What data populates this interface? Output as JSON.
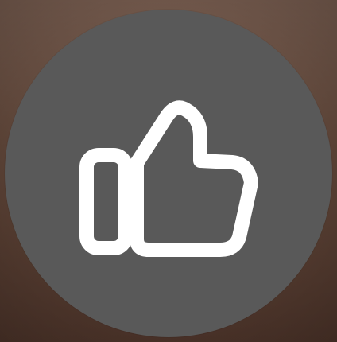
{
  "background": {
    "color_top": "#755b4e",
    "color_bottom": "#4b3329"
  },
  "like_button": {
    "icon": "thumbs-up-icon",
    "fill": "#595959",
    "icon_color": "#ffffff"
  }
}
